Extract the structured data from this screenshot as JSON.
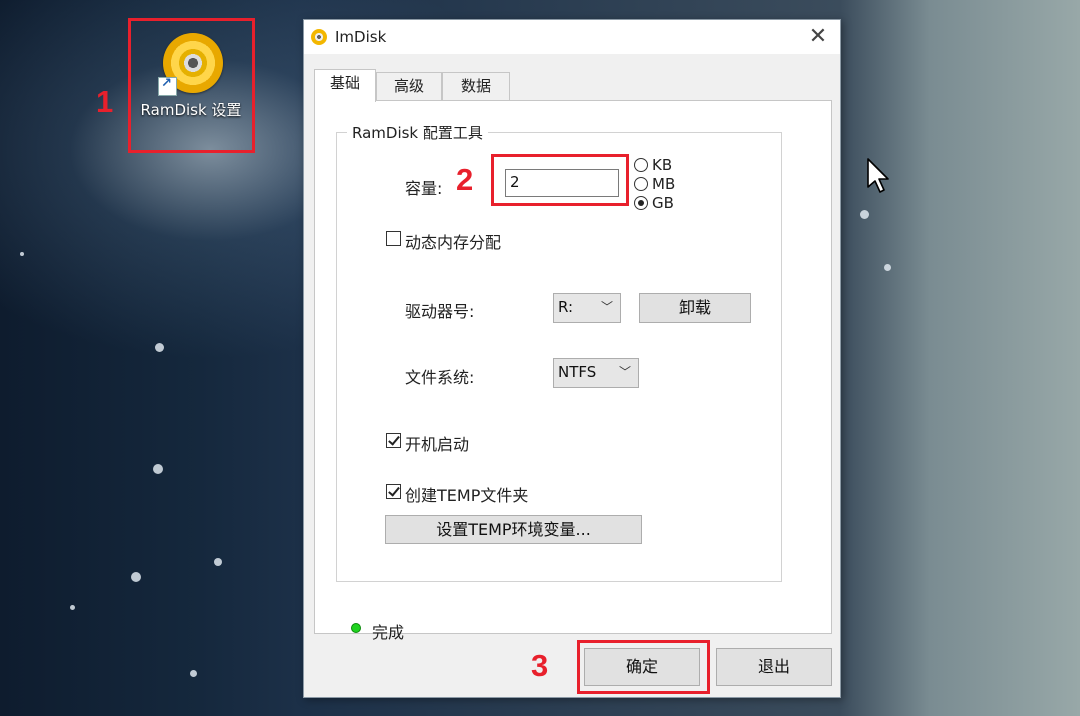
{
  "desktop": {
    "icon_label": "RamDisk 设置"
  },
  "steps": [
    "1",
    "2",
    "3"
  ],
  "dialog": {
    "title": "ImDisk",
    "close_symbol": "✕",
    "tabs": [
      {
        "label": "基础",
        "active": true
      },
      {
        "label": "高级",
        "active": false
      },
      {
        "label": "数据",
        "active": false
      }
    ],
    "group_title": "RamDisk 配置工具",
    "capacity_label": "容量:",
    "capacity_value": "2",
    "units": [
      {
        "label": "KB",
        "selected": false
      },
      {
        "label": "MB",
        "selected": false
      },
      {
        "label": "GB",
        "selected": true
      }
    ],
    "dynamic_memory_label": "动态内存分配",
    "dynamic_memory_checked": false,
    "drive_label": "驱动器号:",
    "drive_value": "R:",
    "unmount_label": "卸载",
    "fs_label": "文件系统:",
    "fs_value": "NTFS",
    "startup_label": "开机启动",
    "startup_checked": true,
    "temp_folder_label": "创建TEMP文件夹",
    "temp_folder_checked": true,
    "temp_env_button": "设置TEMP环境变量...",
    "status_text": "完成",
    "ok_label": "确定",
    "exit_label": "退出"
  },
  "colors": {
    "highlight": "#e8202c",
    "status_led": "#1fd21f",
    "dialog_bg": "#f0f0f0"
  }
}
